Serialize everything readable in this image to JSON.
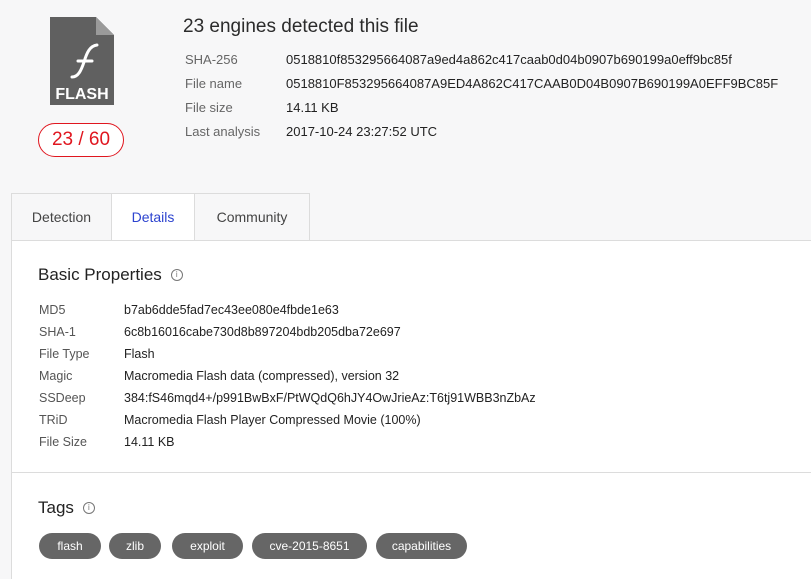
{
  "file": {
    "icon": "flash-file-icon",
    "icon_label": "FLASH",
    "score": "23 / 60",
    "title": "23 engines detected this file",
    "meta": [
      {
        "label": "SHA-256",
        "value": "0518810f853295664087a9ed4a862c417caab0d04b0907b690199a0eff9bc85f"
      },
      {
        "label": "File name",
        "value": "0518810F853295664087A9ED4A862C417CAAB0D04B0907B690199A0EFF9BC85F"
      },
      {
        "label": "File size",
        "value": "14.11 KB"
      },
      {
        "label": "Last analysis",
        "value": "2017-10-24 23:27:52 UTC"
      }
    ]
  },
  "tabs": [
    {
      "label": "Detection",
      "active": false
    },
    {
      "label": "Details",
      "active": true
    },
    {
      "label": "Community",
      "active": false
    }
  ],
  "basic": {
    "title": "Basic Properties",
    "info_icon": "i",
    "rows": [
      {
        "label": "MD5",
        "value": "b7ab6dde5fad7ec43ee080e4fbde1e63"
      },
      {
        "label": "SHA-1",
        "value": "6c8b16016cabe730d8b897204bdb205dba72e697"
      },
      {
        "label": "File Type",
        "value": "Flash"
      },
      {
        "label": "Magic",
        "value": "Macromedia Flash data (compressed), version 32"
      },
      {
        "label": "SSDeep",
        "value": "384:fS46mqd4+/p991BwBxF/PtWQdQ6hJY4OwJrieAz:T6tj91WBB3nZbAz"
      },
      {
        "label": "TRiD",
        "value": "Macromedia Flash Player Compressed Movie (100%)"
      },
      {
        "label": "File Size",
        "value": "14.11 KB"
      }
    ]
  },
  "tags_section": {
    "title": "Tags",
    "info_icon": "i",
    "items": [
      "flash",
      "zlib",
      "exploit",
      "cve-2015-8651",
      "capabilities"
    ]
  },
  "colors": {
    "accent": "#2c43cf",
    "danger": "#e0161f",
    "tag_bg": "#666666",
    "file_icon": "#606060"
  }
}
